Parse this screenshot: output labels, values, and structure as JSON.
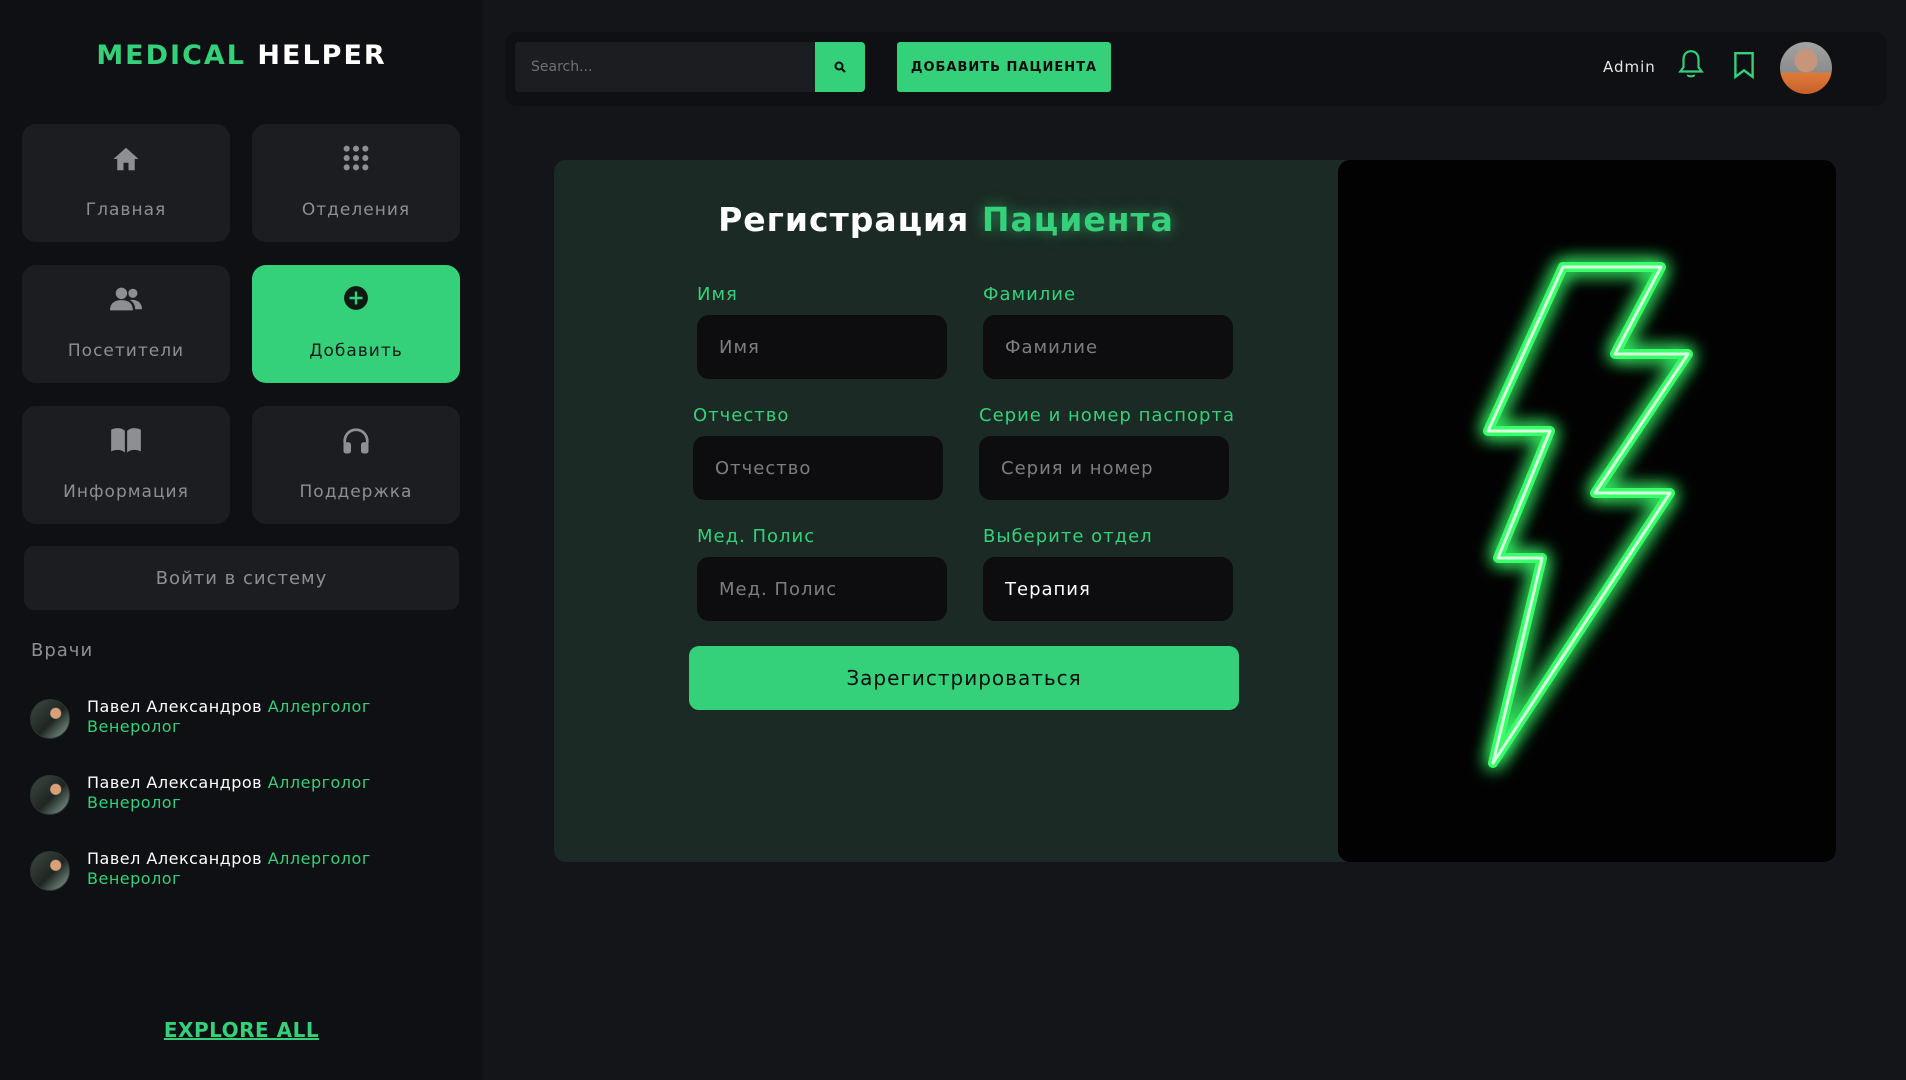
{
  "brand": {
    "part1": "MEDICAL",
    "part2": "HELPER"
  },
  "colors": {
    "accent": "#35d17a",
    "background": "#141518",
    "sidebar": "#0f1013",
    "tile": "#1c1d20"
  },
  "nav": [
    {
      "label": "Главная",
      "icon": "home-icon"
    },
    {
      "label": "Отделения",
      "icon": "grid-icon"
    },
    {
      "label": "Посетители",
      "icon": "users-icon"
    },
    {
      "label": "Добавить",
      "icon": "plus-circle-icon",
      "active": true
    },
    {
      "label": "Информация",
      "icon": "book-icon"
    },
    {
      "label": "Поддержка",
      "icon": "headphones-icon"
    }
  ],
  "login_label": "Войти в систему",
  "doctors": {
    "title": "Врачи",
    "items": [
      {
        "name": "Павел Александров",
        "specialty": "Аллерголог Венеролог"
      },
      {
        "name": "Павел Александров",
        "specialty": "Аллерголог Венеролог"
      },
      {
        "name": "Павел Александров",
        "specialty": "Аллерголог Венеролог"
      }
    ]
  },
  "explore_label": "EXPLORE ALL",
  "topbar": {
    "search_placeholder": "Search...",
    "add_patient_label": "ДОБАВИТЬ ПАЦИЕНТА",
    "user_name": "Admin"
  },
  "form": {
    "title_part1": "Регистрация",
    "title_part2": "Пациента",
    "fields": {
      "first_name": {
        "label": "Имя",
        "placeholder": "Имя"
      },
      "last_name": {
        "label": "Фамилие",
        "placeholder": "Фамилие"
      },
      "patronymic": {
        "label": "Отчество",
        "placeholder": "Отчество"
      },
      "passport": {
        "label": "Серие и номер паспорта",
        "placeholder": "Серия и номер"
      },
      "policy": {
        "label": "Мед. Полис",
        "placeholder": "Мед. Полис"
      },
      "department": {
        "label": "Выберите отдел",
        "value": "Терапия"
      }
    },
    "submit_label": "Зарегистрироваться"
  },
  "illustration": {
    "icon": "neon-lightning-icon"
  }
}
